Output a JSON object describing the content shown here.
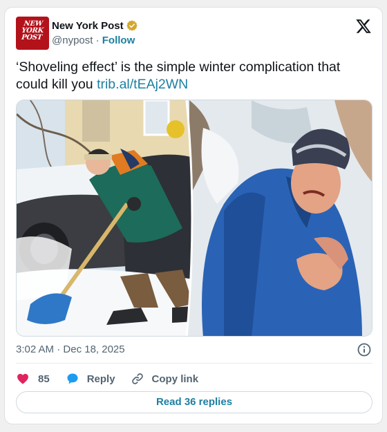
{
  "account": {
    "name": "New York Post",
    "handle": "@nypost",
    "separator": "·",
    "follow_label": "Follow",
    "logo_lines": [
      "NEW",
      "YORK",
      "POST"
    ],
    "brand_color": "#b3121b",
    "verified_icon": "gold-verified-badge",
    "verified_color": "#d4a72c"
  },
  "platform_icon": "x-logo",
  "tweet": {
    "text": "‘Shoveling effect’ is the simple winter complication that could kill you",
    "link": "trib.al/tEAj2WN",
    "link_color": "#1d7fa1"
  },
  "media": {
    "left_panel": "man-shoveling-snow-beside-car",
    "right_panel": "man-in-blue-jacket-clutching-chest"
  },
  "meta": {
    "time": "3:02 AM",
    "separator": "·",
    "date": "Dec 18, 2025",
    "info_icon": "info-icon"
  },
  "actions": {
    "like_count": "85",
    "like_icon": "heart-icon",
    "like_color": "#e0245e",
    "reply_label": "Reply",
    "reply_icon": "speech-bubble-icon",
    "reply_color": "#1d9bf0",
    "copy_label": "Copy link",
    "copy_icon": "link-icon"
  },
  "read_replies": {
    "label": "Read 36 replies"
  }
}
